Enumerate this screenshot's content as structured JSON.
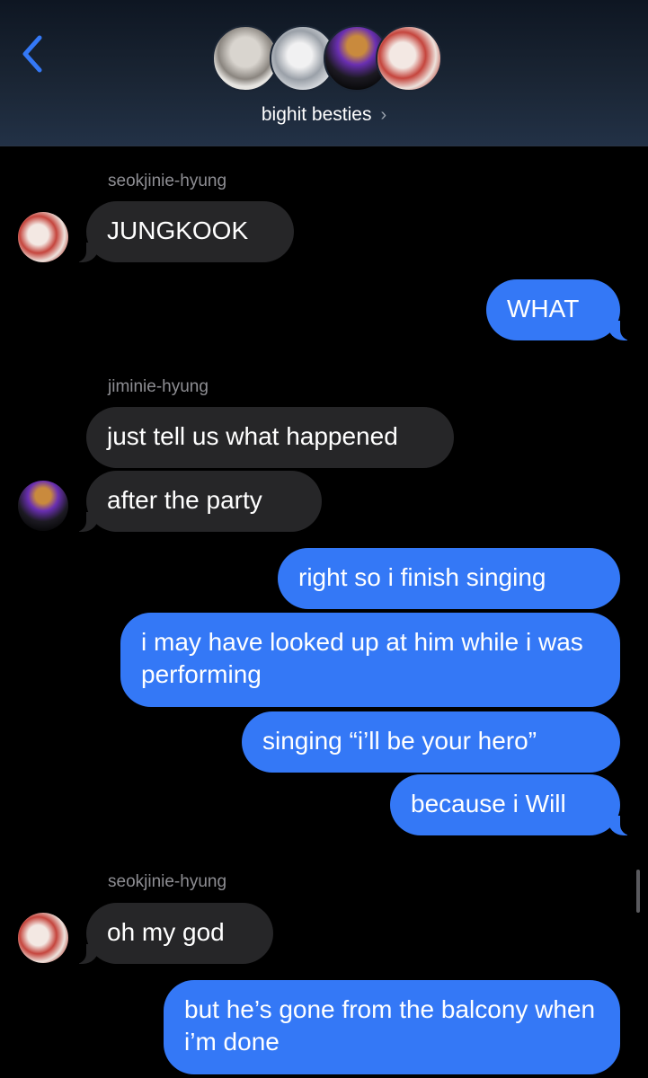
{
  "header": {
    "group_name": "bighit besties",
    "chevron": "›",
    "back_icon": "chevron-left-icon",
    "accent_color": "#3478f6"
  },
  "messages": {
    "sender_1": "seokjinie-hyung",
    "m1": "JUNGKOOK",
    "m2": "WHAT",
    "sender_2": "jiminie-hyung",
    "m3": "just tell us what happened",
    "m4": "after the party",
    "m5": "right so i finish singing",
    "m6": "i may have looked up at him while i was performing",
    "m7": "singing “i’ll be your hero”",
    "m8": "because i Will",
    "sender_3": "seokjinie-hyung",
    "m9": "oh my god",
    "m10": "but he’s gone from the balcony when i’m done"
  },
  "colors": {
    "incoming_bubble": "#262628",
    "outgoing_bubble": "#3478f6",
    "background": "#000000",
    "sender_label": "#8e8e93"
  }
}
